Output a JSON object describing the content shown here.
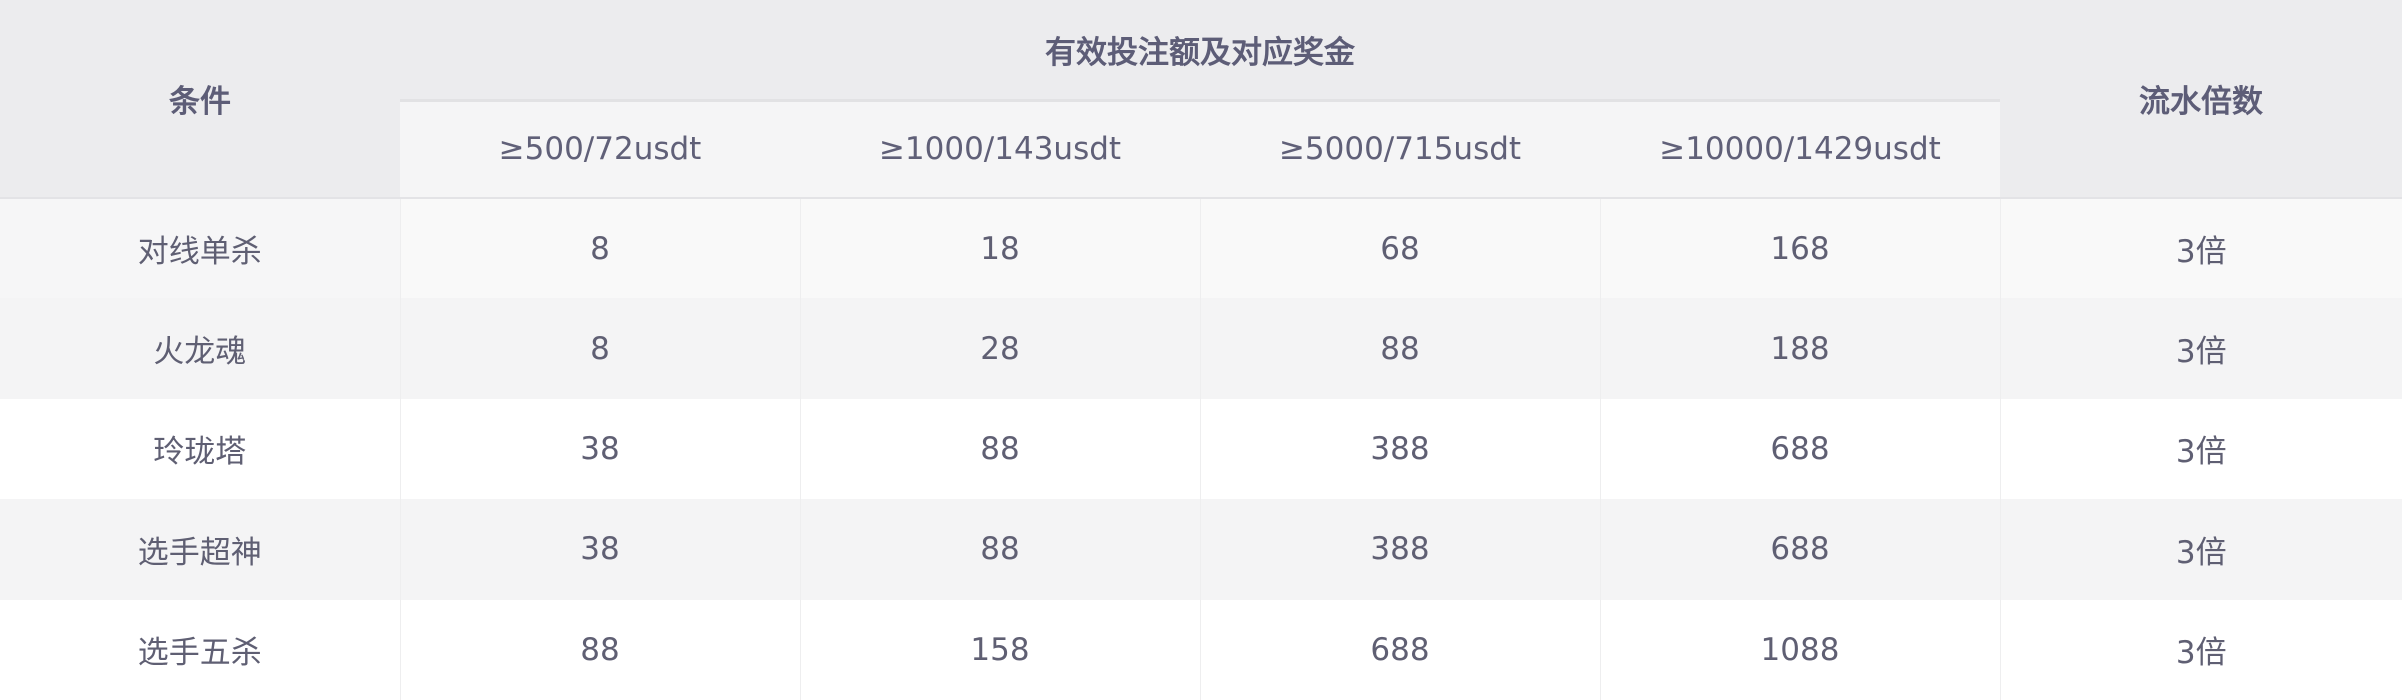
{
  "table": {
    "header": {
      "condition": "条件",
      "group": "有效投注额及对应奖金",
      "multiplier": "流水倍数",
      "tiers": [
        "≥500/72usdt",
        "≥1000/143usdt",
        "≥5000/715usdt",
        "≥10000/1429usdt"
      ]
    },
    "rows": [
      {
        "condition": "对线单杀",
        "bonuses": [
          "8",
          "18",
          "68",
          "168"
        ],
        "multiplier": "3倍"
      },
      {
        "condition": "火龙魂",
        "bonuses": [
          "8",
          "28",
          "88",
          "188"
        ],
        "multiplier": "3倍"
      },
      {
        "condition": "玲珑塔",
        "bonuses": [
          "38",
          "88",
          "388",
          "688"
        ],
        "multiplier": "3倍"
      },
      {
        "condition": "选手超神",
        "bonuses": [
          "38",
          "88",
          "388",
          "688"
        ],
        "multiplier": "3倍"
      },
      {
        "condition": "选手五杀",
        "bonuses": [
          "88",
          "158",
          "688",
          "1088"
        ],
        "multiplier": "3倍"
      }
    ]
  }
}
